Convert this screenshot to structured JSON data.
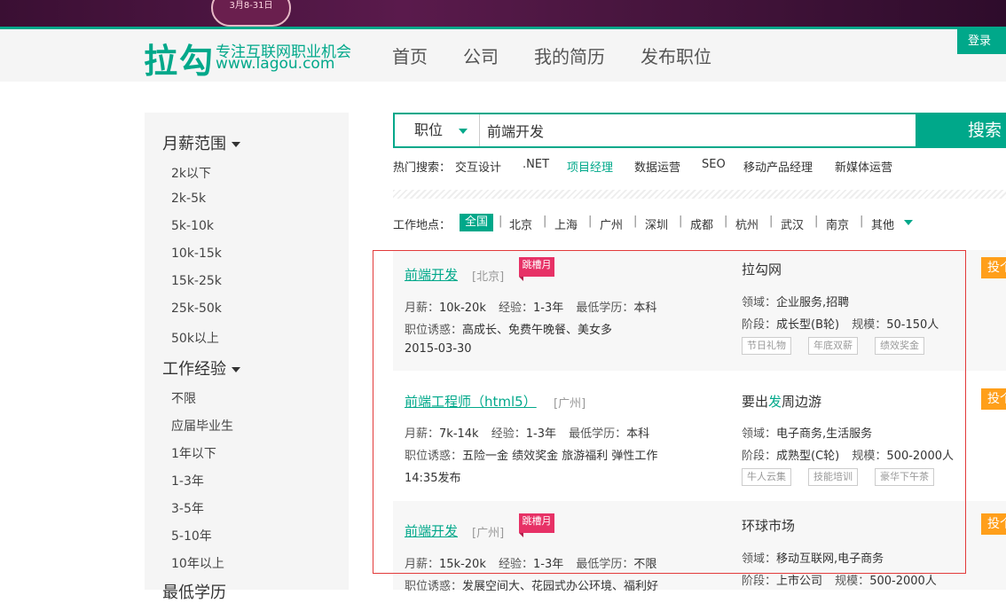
{
  "banner": {
    "badge_text": "3月8-31日"
  },
  "header": {
    "logo_main": "拉勾",
    "logo_tagline": "专注互联网职业机会",
    "logo_url": "www.lagou.com",
    "nav": [
      "首页",
      "公司",
      "我的简历",
      "发布职位"
    ],
    "login_label": "登录"
  },
  "sidebar": {
    "salary_title": "月薪范围",
    "salary_items": [
      "2k以下",
      "2k-5k",
      "5k-10k",
      "10k-15k",
      "15k-25k",
      "25k-50k",
      "50k以上"
    ],
    "experience_title": "工作经验",
    "experience_items": [
      "不限",
      "应届毕业生",
      "1年以下",
      "1-3年",
      "3-5年",
      "5-10年",
      "10年以上"
    ],
    "education_title": "最低学历"
  },
  "search": {
    "type_label": "职位",
    "query": "前端开发",
    "button_label": "搜索",
    "hot_label": "热门搜索：",
    "hot_items": [
      "交互设计",
      ".NET",
      "项目经理",
      "数据运营",
      "SEO",
      "移动产品经理",
      "新媒体运营"
    ]
  },
  "location": {
    "label": "工作地点：",
    "cities": [
      "全国",
      "北京",
      "上海",
      "广州",
      "深圳",
      "成都",
      "杭州",
      "武汉",
      "南京",
      "其他"
    ]
  },
  "jobs": [
    {
      "title": "前端开发",
      "city": "[北京]",
      "badge": "跳槽月",
      "salary_label": "月薪：",
      "salary": "10k-20k",
      "exp_label": "经验：",
      "exp": "1-3年",
      "edu_label": "最低学历：",
      "edu": "本科",
      "perks_label": "职位诱惑：",
      "perks": "高成长、免费午晚餐、美女多",
      "date": "2015-03-30",
      "company": "拉勾网",
      "field_label": "领域：",
      "field": "企业服务,招聘",
      "stage_label": "阶段：",
      "stage": "成长型(B轮)",
      "scale_label": "规模：",
      "scale": "50-150人",
      "tags": [
        "节日礼物",
        "年底双薪",
        "绩效奖金"
      ],
      "apply": "投个"
    },
    {
      "title": "前端工程师（html5）",
      "city": "[广州]",
      "salary_label": "月薪：",
      "salary": "7k-14k",
      "exp_label": "经验：",
      "exp": "1-3年",
      "edu_label": "最低学历：",
      "edu": "本科",
      "perks_label": "职位诱惑：",
      "perks": "五险一金 绩效奖金 旅游福利 弹性工作",
      "date": "14:35发布",
      "company_pre": "要出",
      "company_hl": "发",
      "company_post": "周边游",
      "field_label": "领域：",
      "field": "电子商务,生活服务",
      "stage_label": "阶段：",
      "stage": "成熟型(C轮)",
      "scale_label": "规模：",
      "scale": "500-2000人",
      "tags": [
        "牛人云集",
        "技能培训",
        "豪华下午茶"
      ],
      "apply": "投个"
    },
    {
      "title": "前端开发",
      "city": "[广州]",
      "badge": "跳槽月",
      "salary_label": "月薪：",
      "salary": "15k-20k",
      "exp_label": "经验：",
      "exp": "1-3年",
      "edu_label": "最低学历：",
      "edu": "不限",
      "perks_label": "职位诱惑：",
      "perks": "发展空间大、花园式办公环境、福利好",
      "company": "环球市场",
      "field_label": "领域：",
      "field": "移动互联网,电子商务",
      "stage_label": "阶段：",
      "stage": "上市公司",
      "scale_label": "规模：",
      "scale": "500-2000人",
      "apply": "投个"
    }
  ],
  "colors": {
    "brand": "#00a88a",
    "badge": "#e73166",
    "apply": "#ff9f1a",
    "highlight": "#e23a3a"
  }
}
